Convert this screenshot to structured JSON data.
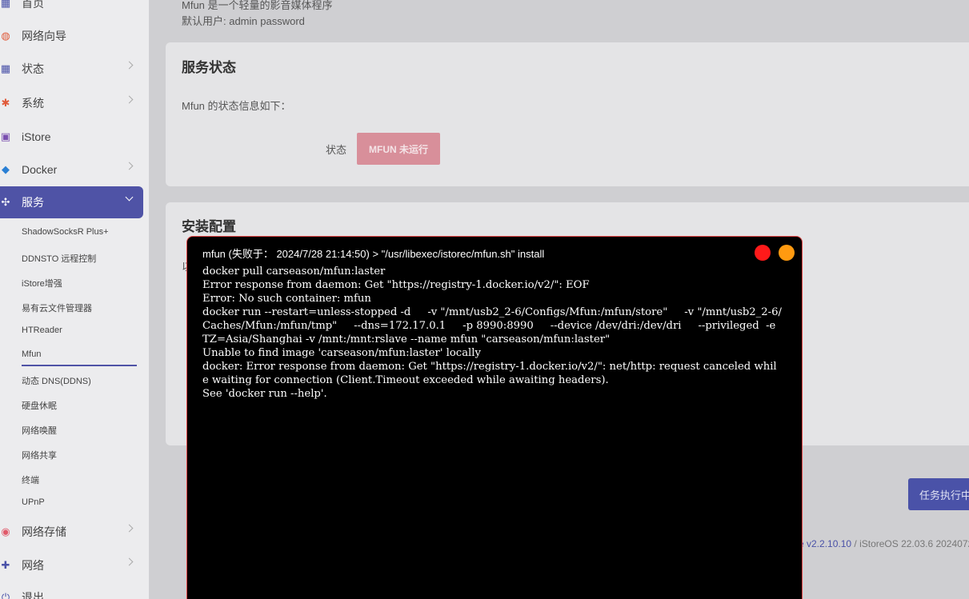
{
  "sidebar": {
    "items": [
      {
        "label": "首页",
        "icon": "home-icon",
        "glyph": "▦",
        "color": "#4a52a8"
      },
      {
        "label": "网络向导",
        "icon": "globe-icon",
        "glyph": "◍",
        "color": "#e05a3a"
      },
      {
        "label": "状态",
        "icon": "grid-icon",
        "glyph": "▦",
        "color": "#4a52a8"
      },
      {
        "label": "系统",
        "icon": "gear-icon",
        "glyph": "✱",
        "color": "#e05a3a"
      },
      {
        "label": "iStore",
        "icon": "store-icon",
        "glyph": "▣",
        "color": "#7a4fb0"
      },
      {
        "label": "Docker",
        "icon": "docker-icon",
        "glyph": "◆",
        "color": "#2a7fd4"
      },
      {
        "label": "服务",
        "icon": "services-icon",
        "glyph": "✣",
        "color": "#ffffff"
      },
      {
        "label": "网络存储",
        "icon": "storage-icon",
        "glyph": "◉",
        "color": "#e05a6a"
      },
      {
        "label": "网络",
        "icon": "network-icon",
        "glyph": "✚",
        "color": "#4a52a8"
      },
      {
        "label": "退出",
        "icon": "logout-icon",
        "glyph": "⏻",
        "color": "#4a52a8"
      }
    ],
    "sub_items": [
      "ShadowSocksR Plus+",
      "DDNSTO 远程控制",
      "iStore增强",
      "易有云文件管理器",
      "HTReader",
      "Mfun",
      "动态 DNS(DDNS)",
      "硬盘休眠",
      "网络唤醒",
      "网络共享",
      "终端",
      "UPnP"
    ]
  },
  "main": {
    "desc_line1": "Mfun 是一个轻量的影音媒体程序",
    "desc_line2": "默认用户: admin password",
    "service_status": {
      "title": "服务状态",
      "intro": "Mfun 的状态信息如下：",
      "label": "状态",
      "badge": "MFUN 未运行"
    },
    "install_config": {
      "title": "安装配置",
      "partial_text": "以"
    },
    "task_button": "任务执行中",
    "footer": {
      "link": "e v2.2.10.10",
      "text": " / iStoreOS 22.03.6 2024072"
    }
  },
  "dialog": {
    "title": "mfun (失败于：  2024/7/28 21:14:50) > \"/usr/libexec/istorec/mfun.sh\" install",
    "log": "docker pull carseason/mfun:laster\nError response from daemon: Get \"https://registry-1.docker.io/v2/\": EOF\nError: No such container: mfun\ndocker run --restart=unless-stopped -d     -v \"/mnt/usb2_2-6/Configs/Mfun:/mfun/store\"     -v \"/mnt/usb2_2-6/Caches/Mfun:/mfun/tmp\"     --dns=172.17.0.1     -p 8990:8990     --device /dev/dri:/dev/dri     --privileged  -e TZ=Asia/Shanghai -v /mnt:/mnt:rslave --name mfun \"carseason/mfun:laster\"\nUnable to find image 'carseason/mfun:laster' locally\ndocker: Error response from daemon: Get \"https://registry-1.docker.io/v2/\": net/http: request canceled while waiting for connection (Client.Timeout exceeded while awaiting headers).\nSee 'docker run --help'."
  },
  "colors": {
    "accent": "#4f53a6",
    "status_badge": "#d88f9a",
    "close_button": "#ff1a1a",
    "minimize_button": "#ff9a10"
  }
}
